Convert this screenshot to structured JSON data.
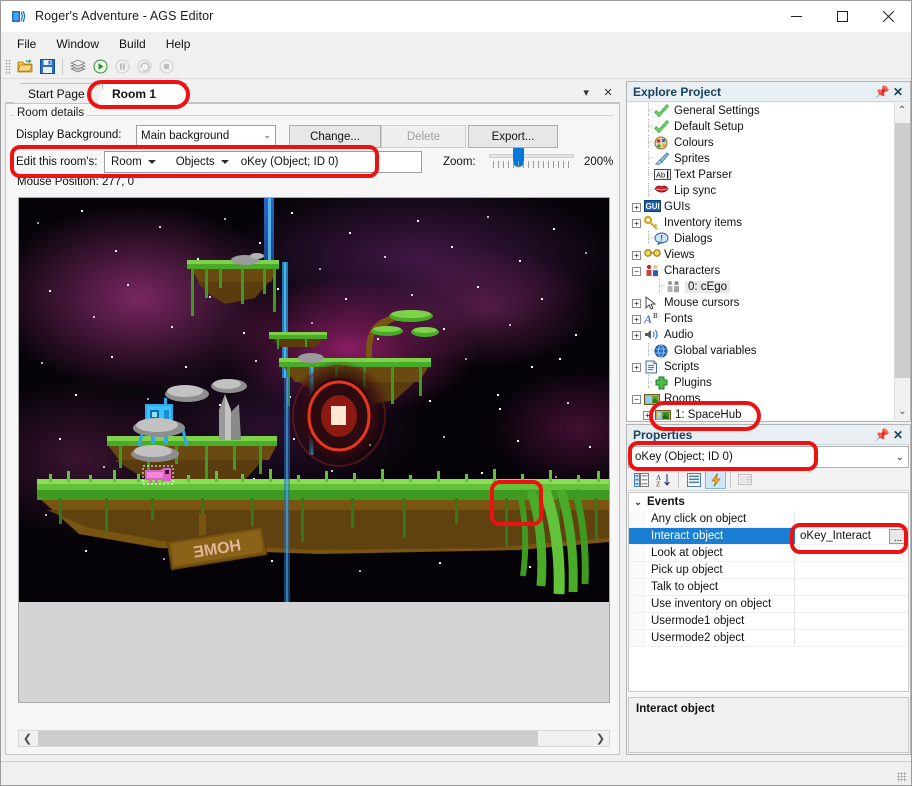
{
  "window": {
    "title": "Roger's Adventure - AGS Editor",
    "icon": "app-icon",
    "minimize": "—",
    "maximize": "□",
    "close": "✕"
  },
  "menubar": {
    "items": [
      "File",
      "Window",
      "Build",
      "Help"
    ]
  },
  "toolbar": {
    "buttons": [
      {
        "name": "open-folder-icon",
        "enabled": true
      },
      {
        "name": "save-icon",
        "enabled": true
      },
      {
        "name": "build-icon",
        "enabled": true
      },
      {
        "name": "run-icon",
        "enabled": true
      },
      {
        "name": "pause-icon",
        "enabled": false
      },
      {
        "name": "step-icon",
        "enabled": false
      },
      {
        "name": "stop-icon",
        "enabled": false
      }
    ]
  },
  "tabs": {
    "items": [
      {
        "label": "Start Page",
        "active": false
      },
      {
        "label": "Room 1",
        "active": true
      }
    ],
    "dropdown_glyph": "▾",
    "close_glyph": "✕"
  },
  "room_editor": {
    "group_title": "Room details",
    "display_background_label": "Display Background:",
    "background_value": "Main background",
    "change_button": "Change...",
    "delete_button": "Delete",
    "export_button": "Export...",
    "edit_room_label": "Edit this room's:",
    "edit_scope": "Room",
    "edit_type": "Objects",
    "edit_target": "oKey (Object; ID 0)",
    "zoom_label": "Zoom:",
    "zoom_value": "200%",
    "mouse_position_label": "Mouse Position: 277, 0",
    "scroll_left_glyph": "❮",
    "scroll_right_glyph": "❯"
  },
  "explore_project": {
    "title": "Explore Project",
    "pin_glyph": "⚐",
    "close_glyph": "✕",
    "scroll_up_glyph": "⌃",
    "scroll_down_glyph": "⌄",
    "nodes": [
      {
        "label": "General Settings",
        "icon": "green-check-icon",
        "indent": 1,
        "expander": "none"
      },
      {
        "label": "Default Setup",
        "icon": "green-check-icon",
        "indent": 1,
        "expander": "none"
      },
      {
        "label": "Colours",
        "icon": "palette-icon",
        "indent": 1,
        "expander": "none"
      },
      {
        "label": "Sprites",
        "icon": "brush-icon",
        "indent": 1,
        "expander": "none"
      },
      {
        "label": "Text Parser",
        "icon": "text-parser-icon",
        "indent": 1,
        "expander": "none"
      },
      {
        "label": "Lip sync",
        "icon": "lips-icon",
        "indent": 1,
        "expander": "none"
      },
      {
        "label": "GUIs",
        "icon": "gui-icon",
        "indent": 0,
        "expander": "plus"
      },
      {
        "label": "Inventory items",
        "icon": "key-icon",
        "indent": 0,
        "expander": "plus"
      },
      {
        "label": "Dialogs",
        "icon": "speech-icon",
        "indent": 1,
        "expander": "none"
      },
      {
        "label": "Views",
        "icon": "glasses-icon",
        "indent": 0,
        "expander": "plus"
      },
      {
        "label": "Characters",
        "icon": "characters-icon",
        "indent": 0,
        "expander": "minus"
      },
      {
        "label": "0: cEgo",
        "icon": "character-icon",
        "indent": 2,
        "expander": "none",
        "selected": true
      },
      {
        "label": "Mouse cursors",
        "icon": "cursor-icon",
        "indent": 0,
        "expander": "plus"
      },
      {
        "label": "Fonts",
        "icon": "font-icon",
        "indent": 0,
        "expander": "plus"
      },
      {
        "label": "Audio",
        "icon": "audio-icon",
        "indent": 0,
        "expander": "plus"
      },
      {
        "label": "Global variables",
        "icon": "globe-icon",
        "indent": 1,
        "expander": "none"
      },
      {
        "label": "Scripts",
        "icon": "script-icon",
        "indent": 0,
        "expander": "plus"
      },
      {
        "label": "Plugins",
        "icon": "plugin-icon",
        "indent": 1,
        "expander": "none"
      },
      {
        "label": "Rooms",
        "icon": "rooms-icon",
        "indent": 0,
        "expander": "minus"
      },
      {
        "label": "1: SpaceHub",
        "icon": "room-icon",
        "indent": 1,
        "expander": "plus"
      }
    ]
  },
  "properties": {
    "title": "Properties",
    "pin_glyph": "⚐",
    "close_glyph": "✕",
    "selected_object": "oKey (Object; ID 0)",
    "dropdown_glyph": "⌄",
    "toolbar_buttons": [
      {
        "name": "categorized-icon",
        "active": false,
        "enabled": true
      },
      {
        "name": "alphabetical-sort-icon",
        "active": false,
        "enabled": true
      },
      {
        "name": "properties-page-icon",
        "active": false,
        "enabled": true
      },
      {
        "name": "events-lightning-icon",
        "active": true,
        "enabled": true
      },
      {
        "name": "property-pages-icon",
        "active": false,
        "enabled": false
      }
    ],
    "category": "Events",
    "category_chevron": "⌄",
    "rows": [
      {
        "name": "Any click on object",
        "value": "",
        "selected": false
      },
      {
        "name": "Interact object",
        "value": "oKey_Interact",
        "selected": true
      },
      {
        "name": "Look at object",
        "value": "",
        "selected": false
      },
      {
        "name": "Pick up object",
        "value": "",
        "selected": false
      },
      {
        "name": "Talk to object",
        "value": "",
        "selected": false
      },
      {
        "name": "Use inventory on object",
        "value": "",
        "selected": false
      },
      {
        "name": "Usermode1 object",
        "value": "",
        "selected": false
      },
      {
        "name": "Usermode2 object",
        "value": "",
        "selected": false
      }
    ],
    "browse_glyph": "...",
    "description_title": "Interact object"
  },
  "room_art": {
    "sign_text": "HOME",
    "highlighted_object": "oKey",
    "object_color": "#e060c8"
  },
  "annotations": {
    "color": "#ee1111",
    "items": [
      "room-1-tab-highlight",
      "edit-this-rooms-row-highlight",
      "key-object-in-canvas-highlight",
      "spacehub-room-node-highlight",
      "properties-object-dropdown-highlight",
      "interact-object-value-highlight"
    ]
  }
}
